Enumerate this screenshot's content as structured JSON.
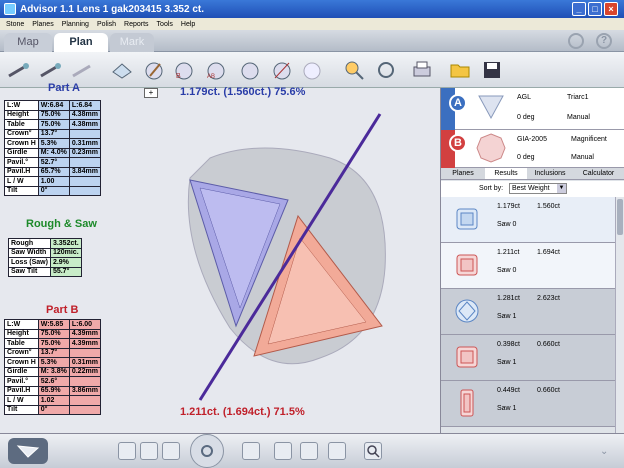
{
  "window": {
    "title": "Advisor 1.1 Lens 1 gak203415 3.352 ct."
  },
  "menu": [
    "Stone",
    "Planes",
    "Planning",
    "Polish",
    "Reports",
    "Tools",
    "Help"
  ],
  "tabs": [
    "Map",
    "Plan",
    "Mark"
  ],
  "canvas": {
    "top_label": "1.179ct. (1.560ct.) 75.6%",
    "bottom_label": "1.211ct. (1.694ct.) 71.5%"
  },
  "partA": {
    "title": "Part A",
    "rows": [
      [
        "L:W",
        "W:6.84",
        "L:6.84"
      ],
      [
        "Height",
        "75.0%",
        "4.38mm"
      ],
      [
        "Table",
        "75.0%",
        "4.38mm"
      ],
      [
        "Crown°",
        "13.7°",
        ""
      ],
      [
        "Crown H",
        "5.3%",
        "0.31mm"
      ],
      [
        "Girdle",
        "M: 4.0%",
        "0.23mm"
      ],
      [
        "Pavil.°",
        "52.7°",
        ""
      ],
      [
        "Pavil.H",
        "65.7%",
        "3.84mm"
      ],
      [
        "L / W",
        "1.00",
        ""
      ],
      [
        "Tilt",
        "0°",
        ""
      ]
    ]
  },
  "rough": {
    "title": "Rough & Saw",
    "rows": [
      [
        "Rough",
        "3.352ct."
      ],
      [
        "Saw Width",
        "120mic."
      ],
      [
        "Loss (Saw)",
        "2.9%"
      ],
      [
        "Saw Tilt",
        "55.7°"
      ]
    ]
  },
  "partB": {
    "title": "Part B",
    "rows": [
      [
        "L:W",
        "W:5.85",
        "L:6.00"
      ],
      [
        "Height",
        "75.0%",
        "4.39mm"
      ],
      [
        "Table",
        "75.0%",
        "4.39mm"
      ],
      [
        "Crown°",
        "13.7°",
        ""
      ],
      [
        "Crown H",
        "5.3%",
        "0.31mm"
      ],
      [
        "Girdle",
        "M: 3.8%",
        "0.22mm"
      ],
      [
        "Pavil.°",
        "52.6°",
        ""
      ],
      [
        "Pavil.H",
        "65.9%",
        "3.86mm"
      ],
      [
        "L / W",
        "1.02",
        ""
      ],
      [
        "Tilt",
        "0°",
        ""
      ]
    ]
  },
  "right": {
    "a": {
      "letter": "A",
      "lab": "AGL",
      "cut": "Triarc1",
      "deg": "0 deg",
      "mode": "Manual"
    },
    "b": {
      "letter": "B",
      "lab": "GIA-2005",
      "cut": "Magnificent",
      "deg": "0 deg",
      "mode": "Manual"
    },
    "tabs": [
      "Planes",
      "Results",
      "Inclusions",
      "Calculator"
    ],
    "sort_label": "Sort by:",
    "sort_value": "Best Weight",
    "results": [
      {
        "c1": "1.179ct",
        "c2": "1.560ct",
        "saw": "Saw 0"
      },
      {
        "c1": "1.211ct",
        "c2": "1.694ct",
        "saw": "Saw 0"
      },
      {
        "c1": "1.281ct",
        "c2": "2.623ct",
        "saw": "Saw 1"
      },
      {
        "c1": "0.398ct",
        "c2": "0.660ct",
        "saw": "Saw 1"
      },
      {
        "c1": "0.449ct",
        "c2": "0.660ct",
        "saw": "Saw 1"
      }
    ]
  }
}
